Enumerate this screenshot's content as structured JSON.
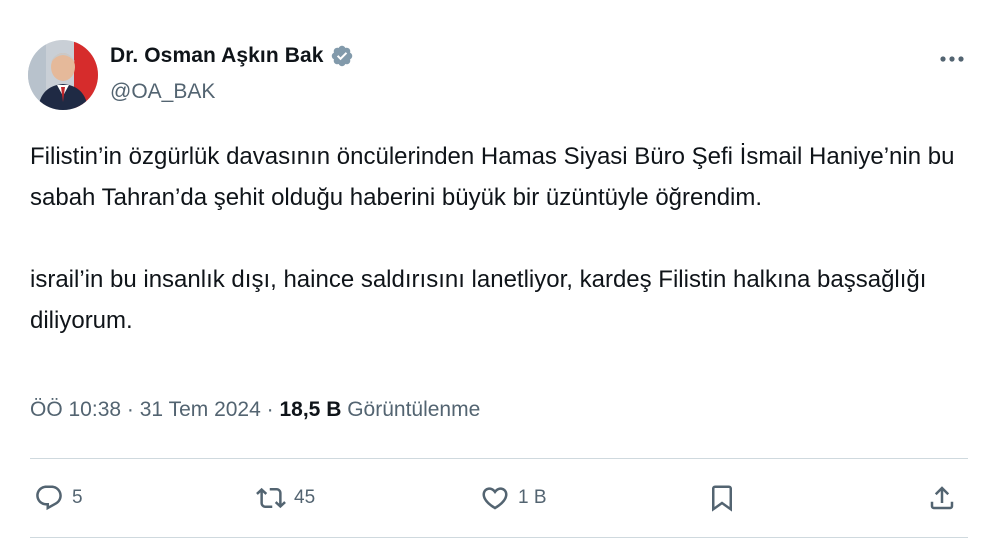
{
  "author": {
    "display_name": "Dr. Osman Aşkın Bak",
    "handle": "@OA_BAK",
    "verified": true
  },
  "tweet": {
    "paragraphs": [
      "Filistin’in özgürlük davasının öncülerinden Hamas Siyasi Büro Şefi İsmail Haniye’nin bu sabah Tahran’da şehit olduğu haberini büyük bir üzüntüyle öğrendim.",
      "israil’in bu insanlık dışı, haince saldırısını lanetliyor, kardeş Filistin halkına başsağlığı diliyorum."
    ],
    "time": "ÖÖ 10:38",
    "date": "31 Tem 2024",
    "separator": "·",
    "views_count": "18,5 B",
    "views_label": "Görüntülenme"
  },
  "actions": {
    "reply_count": "5",
    "retweet_count": "45",
    "like_count": "1 B"
  },
  "icons": {
    "verified": "verified-badge-icon",
    "more": "more-options-icon",
    "reply": "reply-icon",
    "retweet": "retweet-icon",
    "like": "heart-icon",
    "bookmark": "bookmark-icon",
    "share": "share-icon"
  },
  "colors": {
    "text_primary": "#0f1419",
    "text_secondary": "#536471",
    "divider": "#cfd9de",
    "verified_badge": "#829aab"
  }
}
